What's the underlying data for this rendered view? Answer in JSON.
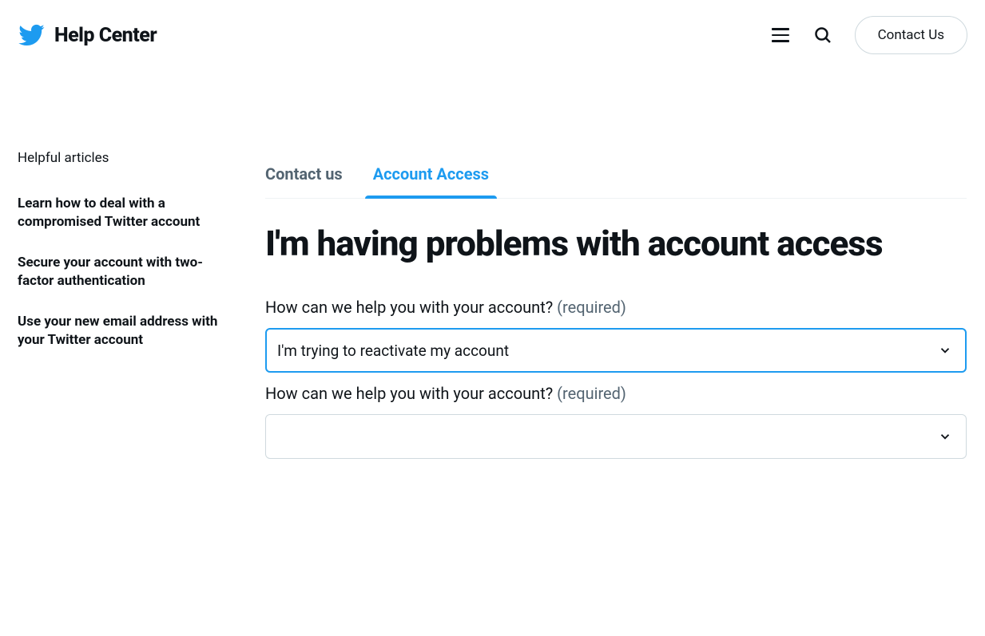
{
  "header": {
    "site_title": "Help Center",
    "contact_button": "Contact Us"
  },
  "sidebar": {
    "title": "Helpful articles",
    "links": [
      "Learn how to deal with a compromised Twitter account",
      "Secure your account with two-factor authentication",
      "Use your new email address with your Twitter account"
    ]
  },
  "tabs": {
    "contact_us": "Contact us",
    "account_access": "Account Access"
  },
  "main": {
    "heading": "I'm having problems with account access",
    "question_label": "How can we help you with your account?",
    "required_text": "(required)",
    "select1_value": "I'm trying to reactivate my account",
    "select2_value": ""
  }
}
